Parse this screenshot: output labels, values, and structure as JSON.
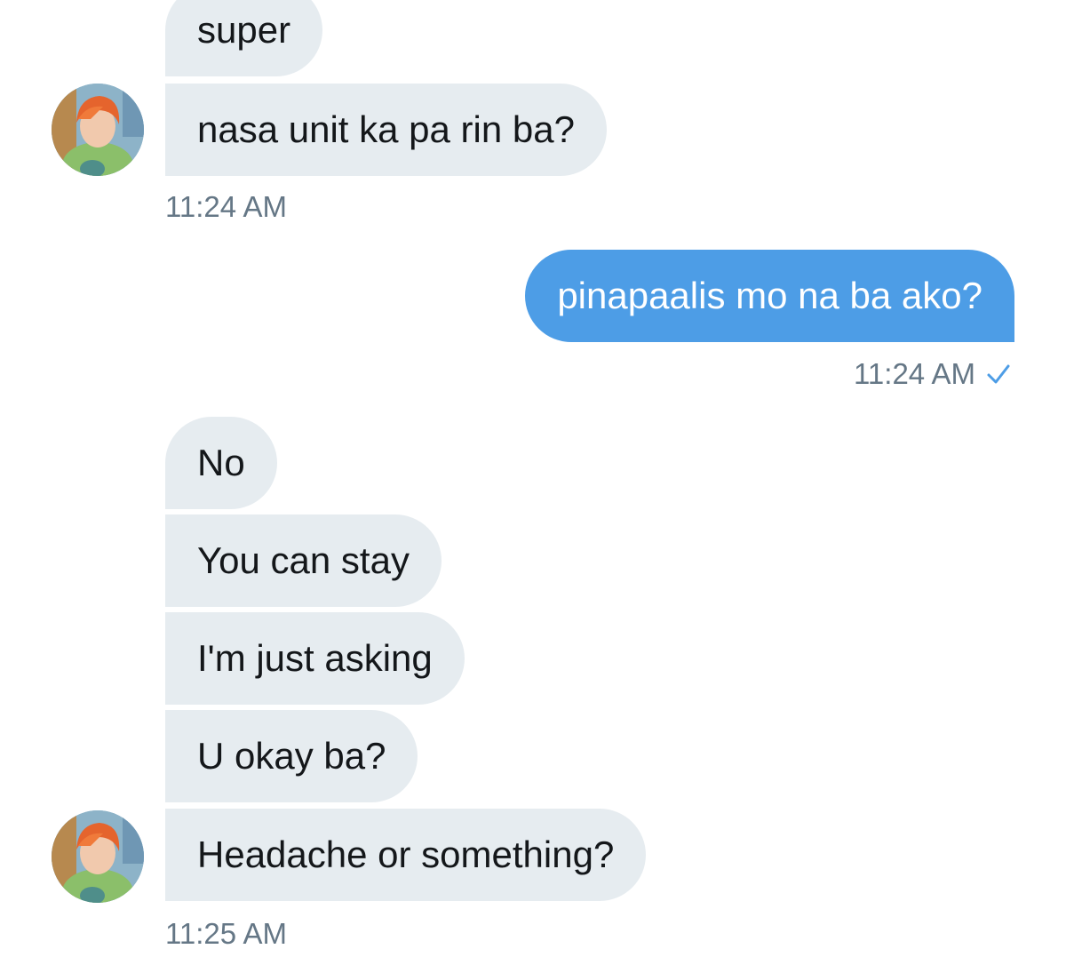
{
  "conversation": {
    "messages": [
      {
        "side": "in",
        "text": "super"
      },
      {
        "side": "in",
        "text": "nasa unit ka pa rin ba?"
      },
      {
        "side": "out",
        "text": "pinapaalis mo na ba ako?"
      },
      {
        "side": "in",
        "text": "No"
      },
      {
        "side": "in",
        "text": "You can stay"
      },
      {
        "side": "in",
        "text": "I'm just asking"
      },
      {
        "side": "in",
        "text": "U okay ba?"
      },
      {
        "side": "in",
        "text": "Headache or something?"
      }
    ],
    "timestamps": {
      "group1": "11:24 AM",
      "group2": "11:24 AM",
      "group3": "11:25 AM"
    },
    "read_receipt_icon": "checkmark-icon",
    "avatar_icon": "profile-avatar",
    "colors": {
      "incoming_bubble": "#e6ecf0",
      "outgoing_bubble": "#4d9de6",
      "timestamp": "#657786",
      "check": "#4d9de6"
    }
  }
}
